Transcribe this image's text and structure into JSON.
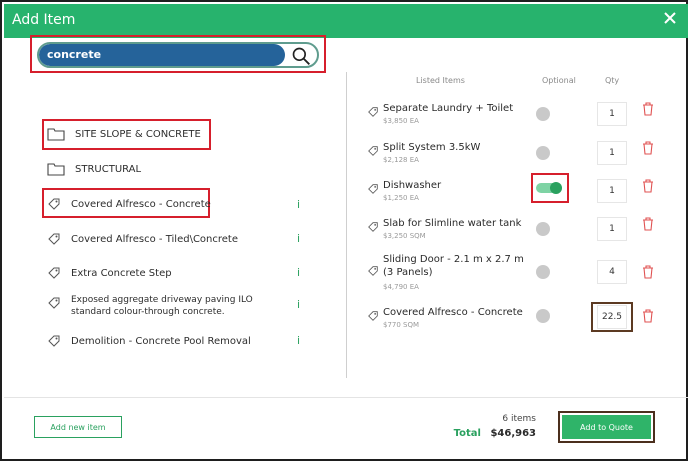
{
  "dialog": {
    "title": "Add Item"
  },
  "search": {
    "value": "concrete"
  },
  "results": [
    {
      "label": "SITE SLOPE & CONCRETE",
      "type": "folder"
    },
    {
      "label": "STRUCTURAL",
      "type": "folder"
    },
    {
      "label": "Covered Alfresco - Concrete",
      "type": "item",
      "info": "i"
    },
    {
      "label": "Covered Alfresco - Tiled\\Concrete",
      "type": "item",
      "info": "i"
    },
    {
      "label": "Extra Concrete Step",
      "type": "item",
      "info": "i"
    },
    {
      "label": "Exposed aggregate driveway paving ILO standard colour-through concrete.",
      "type": "item",
      "info": "i"
    },
    {
      "label": "Demolition - Concrete Pool Removal",
      "type": "item",
      "info": "i"
    }
  ],
  "listed": {
    "headers": {
      "items": "Listed Items",
      "optional": "Optional",
      "qty": "Qty"
    },
    "rows": [
      {
        "name": "Separate Laundry + Toilet",
        "price": "$3,850 EA",
        "optional": false,
        "qty": "1"
      },
      {
        "name": "Split System 3.5kW",
        "price": "$2,128 EA",
        "optional": false,
        "qty": "1"
      },
      {
        "name": "Dishwasher",
        "price": "$1,250 EA",
        "optional": true,
        "qty": "1"
      },
      {
        "name": "Slab for Slimline water tank",
        "price": "$3,250 SQM",
        "optional": false,
        "qty": "1"
      },
      {
        "name": "Sliding Door - 2.1 m x 2.7 m (3 Panels)",
        "price": "$4,790 EA",
        "optional": false,
        "qty": "4"
      },
      {
        "name": "Covered Alfresco - Concrete",
        "price": "$770 SQM",
        "optional": false,
        "qty": "22.5"
      }
    ]
  },
  "footer": {
    "add_new": "Add new item",
    "items_count": "6 items",
    "total_label": "Total",
    "total_value": "$46,963",
    "add_quote": "Add to Quote"
  },
  "colors": {
    "brand": "#27b36d",
    "search": "#25639a",
    "highlight": "#d61f2c",
    "delete": "#e05252"
  }
}
